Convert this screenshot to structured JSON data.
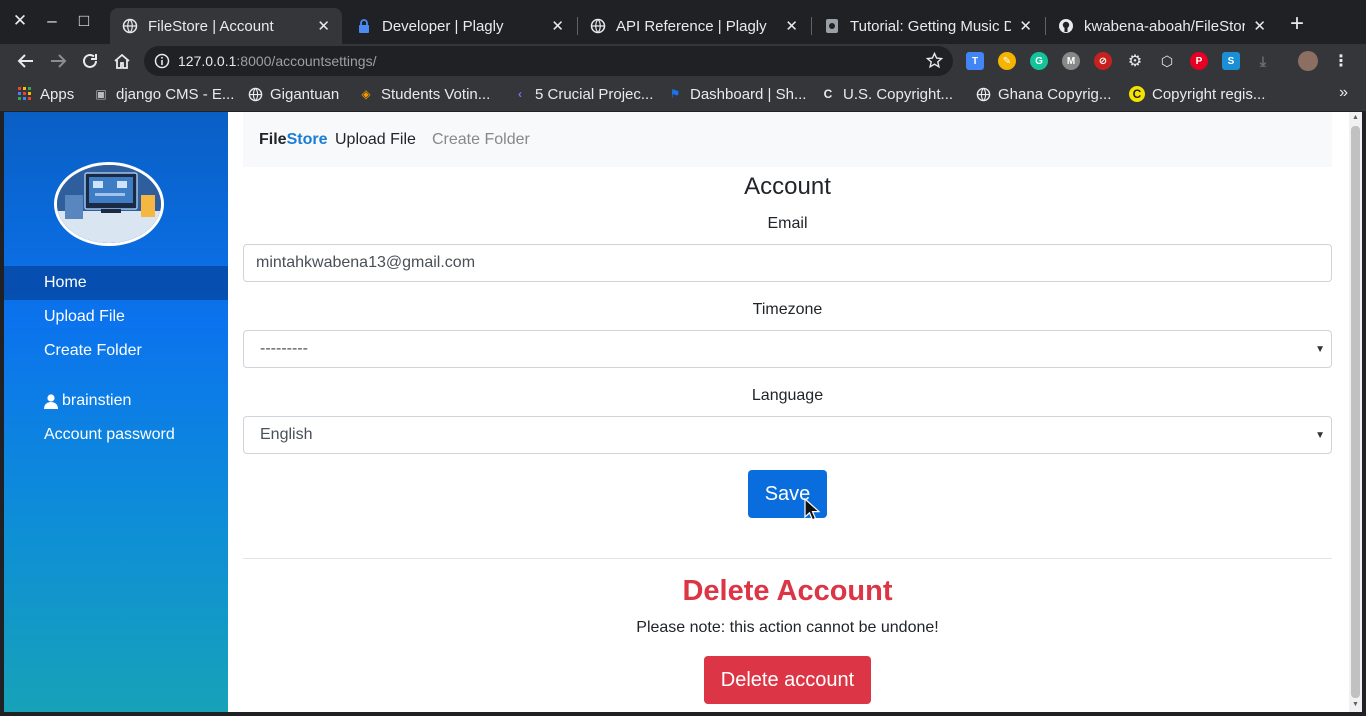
{
  "window": {
    "close_label": "✕",
    "minimize_label": "–",
    "maximize_label": "□"
  },
  "tabs": [
    {
      "title": "FileStore | Account",
      "icon": "globe-icon",
      "active": true
    },
    {
      "title": "Developer | Plagly",
      "icon": "lock-icon",
      "active": false
    },
    {
      "title": "API Reference | Plagly",
      "icon": "globe-icon",
      "active": false
    },
    {
      "title": "Tutorial: Getting Music Da",
      "icon": "site-icon",
      "active": false
    },
    {
      "title": "kwabena-aboah/FileStor",
      "icon": "github-icon",
      "active": false
    }
  ],
  "tab_close_label": "✕",
  "new_tab_label": "+",
  "address": {
    "host": "127.0.0.1",
    "rest": ":8000/accountsettings/"
  },
  "bookmarks": [
    {
      "label": "Apps",
      "icon": "apps-grid-icon"
    },
    {
      "label": "django CMS - E...",
      "icon": "cms-icon"
    },
    {
      "label": "Gigantuan",
      "icon": "globe-icon"
    },
    {
      "label": "Students Votin...",
      "icon": "diamond-icon"
    },
    {
      "label": "5 Crucial Projec...",
      "icon": "chevron-icon"
    },
    {
      "label": "Dashboard | Sh...",
      "icon": "bookmark-flag-icon"
    },
    {
      "label": "U.S. Copyright...",
      "icon": "c-icon"
    },
    {
      "label": "Ghana Copyrig...",
      "icon": "globe-icon"
    },
    {
      "label": "Copyright regis...",
      "icon": "copyright-icon"
    }
  ],
  "bookmarks_more": "»",
  "sidebar": {
    "items": [
      {
        "label": "Home",
        "active": true
      },
      {
        "label": "Upload File",
        "active": false
      },
      {
        "label": "Create Folder",
        "active": false
      }
    ],
    "user": "brainstien",
    "account_password": "Account password"
  },
  "navbar": {
    "brand_a": "File",
    "brand_b": "Store",
    "links": [
      {
        "label": "Upload File",
        "color": "#212529"
      },
      {
        "label": "Create Folder",
        "color": "#888888"
      }
    ]
  },
  "form": {
    "title": "Account",
    "email_label": "Email",
    "email_value": "mintahkwabena13@gmail.com",
    "timezone_label": "Timezone",
    "timezone_value": "---------",
    "language_label": "Language",
    "language_value": "English",
    "save_label": "Save"
  },
  "danger": {
    "title": "Delete Account",
    "note": "Please note: this action cannot be undone!",
    "button_label": "Delete account"
  },
  "colors": {
    "primary": "#0a6ddd",
    "danger": "#dc3545",
    "brand_accent": "#1a7cd6",
    "chrome_dark": "#202124",
    "chrome_toolbar": "#35363a"
  }
}
